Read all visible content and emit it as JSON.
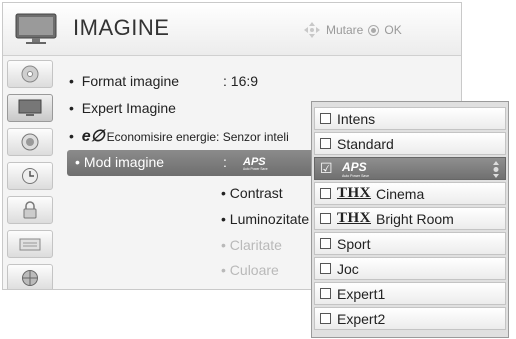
{
  "header": {
    "title": "IMAGINE",
    "hint_mute": "Mutare",
    "hint_ok": "OK"
  },
  "sidebar": {
    "icons": [
      "disc-icon",
      "tv-picture-icon",
      "speaker-icon",
      "clock-icon",
      "lock-icon",
      "keyboard-icon",
      "globe-icon"
    ],
    "active_index": 1
  },
  "menu": {
    "format": {
      "label": "Format imagine",
      "value": ": 16:9"
    },
    "expert": {
      "label": "Expert Imagine"
    },
    "eco": {
      "logo": "e∅",
      "label": "Economisire energie",
      "value": ": Senzor inteli"
    },
    "mode": {
      "label": "Mod imagine",
      "colon": ":",
      "value_logo": "APS",
      "value_sub": "Auto Power Save"
    },
    "sub_items": [
      {
        "label": "• Contrast",
        "dim": false
      },
      {
        "label": "• Luminozitate",
        "dim": false
      },
      {
        "label": "• Claritate",
        "dim": true
      },
      {
        "label": "• Culoare",
        "dim": true
      }
    ]
  },
  "dropdown": {
    "options": [
      {
        "label": "Intens",
        "selected": false
      },
      {
        "label": "Standard",
        "selected": false
      },
      {
        "label": "APS",
        "sub": "Auto Power Save",
        "selected": true
      },
      {
        "thx": "THX",
        "label": "Cinema",
        "selected": false
      },
      {
        "thx": "THX",
        "label": "Bright Room",
        "selected": false
      },
      {
        "label": "Sport",
        "selected": false
      },
      {
        "label": "Joc",
        "selected": false
      },
      {
        "label": "Expert1",
        "selected": false
      },
      {
        "label": "Expert2",
        "selected": false
      }
    ],
    "checkmark": "☑"
  },
  "colors": {
    "highlight": "#7c7c7c",
    "panel": "#f4f4f4",
    "dim_text": "#b9b9b9"
  }
}
